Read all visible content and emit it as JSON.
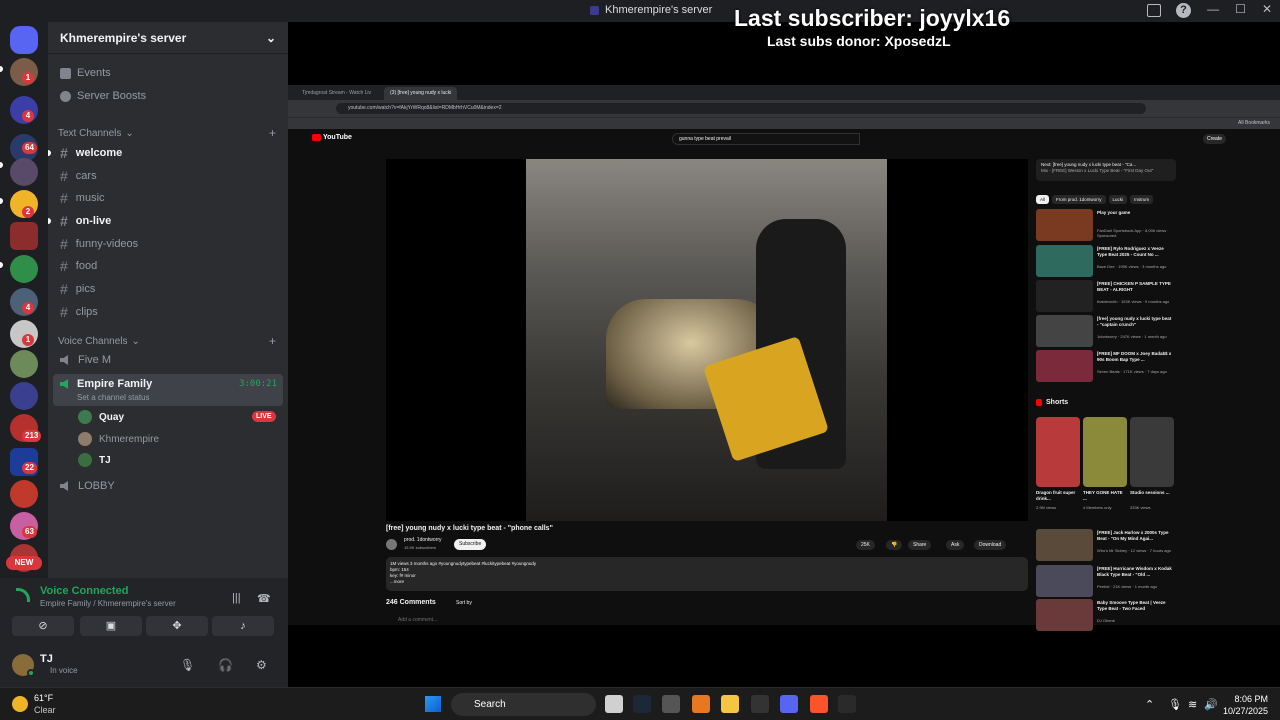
{
  "window": {
    "title": "Khmerempire's server"
  },
  "overlay": {
    "last_subscriber": "Last subscriber: joyylx16",
    "last_donor": "Last subs donor: XposedzL"
  },
  "rail": {
    "badges": [
      "1",
      "4",
      "64",
      "2",
      "4",
      "1",
      "213",
      "22",
      "63"
    ],
    "new_label": "NEW"
  },
  "sidebar": {
    "server_name": "Khmerempire's server",
    "top_items": [
      {
        "label": "Events",
        "icon": "calendar-icon"
      },
      {
        "label": "Server Boosts",
        "icon": "boost-icon"
      }
    ],
    "text_category": "Text Channels",
    "text_channels": [
      {
        "label": "welcome",
        "unread": true
      },
      {
        "label": "cars",
        "unread": false
      },
      {
        "label": "music",
        "unread": false
      },
      {
        "label": "on-live",
        "unread": true
      },
      {
        "label": "funny-videos",
        "unread": false
      },
      {
        "label": "food",
        "unread": false
      },
      {
        "label": "pics",
        "unread": false
      },
      {
        "label": "clips",
        "unread": false
      }
    ],
    "voice_category": "Voice Channels",
    "voice_channels": {
      "five_m": "Five M",
      "empire_family": "Empire Family",
      "empire_time": "3:00:21",
      "set_status": "Set a channel status",
      "members": [
        "Quay",
        "Khmerempire",
        "TJ"
      ],
      "live_badge": "LIVE",
      "lobby": "LOBBY"
    }
  },
  "voice_panel": {
    "status": "Voice Connected",
    "location": "Empire Family / Khmerempire's server"
  },
  "user": {
    "name": "TJ",
    "status": "In voice"
  },
  "browser": {
    "tabs": [
      "Tjmdagroat Stream - Watch Liv",
      "(3) [free] young nudy x lucki"
    ],
    "url": "youtube.com/watch?v=fAkjYrWRqo8&list=RDMbHrhVCu0M&index=2",
    "all_bookmarks": "All Bookmarks"
  },
  "youtube": {
    "logo": "YouTube",
    "search_query": "gunna type beat prevail",
    "create": "Create",
    "video_title": "[free] young nudy x lucki type beat - \"phone calls\"",
    "channel": "prod. 1dontworry",
    "subscribers": "15.9K subscribers",
    "subscribe": "Subscribe",
    "likes": "25K",
    "share": "Share",
    "ask": "Ask",
    "download": "Download",
    "desc_line1": "1M views  3 months ago  #youngnudytypebeat #luckitypebeat #youngnudy",
    "desc_line2": "bpm: 154",
    "desc_line3": "key: f# minor",
    "desc_more": "...more",
    "comments": "246 Comments",
    "sort_by": "Sort by",
    "add_comment": "Add a comment...",
    "next_label": "Next: [free] young nudy x lucki type beat - \"Ca...",
    "next_sub": "Mix - [FREE] Weston x Lucki Type Beat - \"First Day Out\"",
    "chips": [
      "All",
      "From prod. 1dontworry",
      "Lucki",
      "Instrum"
    ],
    "related": [
      {
        "title": "Play your game",
        "meta": "FanDuel Sportsbook App · 8,006 views · Sponsored"
      },
      {
        "title": "[FREE] Rylo Rodriguez x Veeze Type Beat 2025 - Count No ...",
        "meta": "Baze Dee · 195K views · 3 months ago"
      },
      {
        "title": "[FREE] CHICKEN P SAMPLE TYPE BEAT - ALRIGHT",
        "meta": "thatdecichh · 153K views · 9 months ago"
      },
      {
        "title": "[free] young nudy x lucki type beat - \"captain crunch\"",
        "meta": "1dontworry · 247K views · 1 month ago"
      },
      {
        "title": "[FREE] MF DOOM x Joey Bada$$ x 90s Boom Bap Type ...",
        "meta": "Seven Beats · 171K views · 7 days ago"
      }
    ],
    "shorts_title": "Shorts",
    "shorts": [
      {
        "title": "Dragon fruit super drink...",
        "views": "2.9M views"
      },
      {
        "title": "THEY GONE HATE ...",
        "views": "4 Members only"
      },
      {
        "title": "Studio sessions ...",
        "views": "333K views"
      }
    ],
    "related2": [
      {
        "title": "[FREE] Jack Harlow x 2000s Type Beat - \"On My Mind Agai...",
        "meta": "Who's Mr Sidney · 12 views · 7 hours ago"
      },
      {
        "title": "[FREE] Hurricane Wisdom x Kodak Black Type Beat - \"Old ...",
        "meta": "Peebsf · 21K views · 1 month ago"
      },
      {
        "title": "Baby Smoove Type Beat | Veeze Type Beat - Two Faced",
        "meta": "DJ Obene"
      }
    ]
  },
  "taskbar": {
    "temp": "61°F",
    "condition": "Clear",
    "search": "Search",
    "time": "8:06 PM",
    "date": "10/27/2025"
  }
}
